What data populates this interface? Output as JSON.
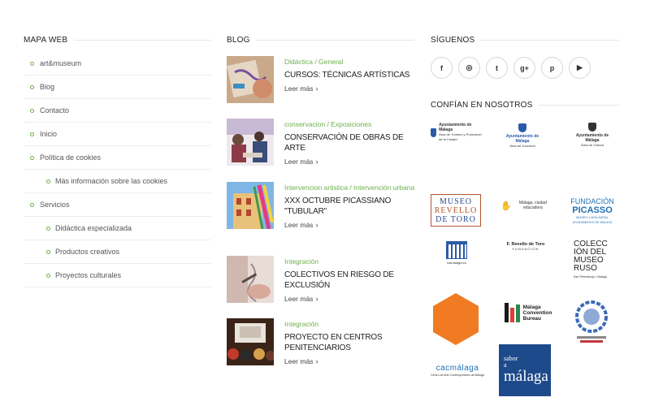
{
  "sitemap": {
    "heading": "MAPA WEB",
    "items": [
      {
        "label": "art&museum",
        "level": 1
      },
      {
        "label": "Blog",
        "level": 1
      },
      {
        "label": "Contacto",
        "level": 1
      },
      {
        "label": "Inicio",
        "level": 1
      },
      {
        "label": "Política de cookies",
        "level": 1
      },
      {
        "label": "Más información sobre las cookies",
        "level": 2
      },
      {
        "label": "Servicios",
        "level": 1
      },
      {
        "label": "Didáctica especializada",
        "level": 2
      },
      {
        "label": "Productos creativos",
        "level": 2
      },
      {
        "label": "Proyectos culturales",
        "level": 2
      }
    ]
  },
  "blog": {
    "heading": "BLOG",
    "read_more": "Leer más",
    "posts": [
      {
        "category": "Didáctica / General",
        "title": "CURSOS: TÉCNICAS ARTÍSTICAS"
      },
      {
        "category": "conservacion / Exposiciones",
        "title": "CONSERVACIÓN DE OBRAS DE ARTE"
      },
      {
        "category": "Intervencion artistica / Intervención urbana",
        "title": "XXX OCTUBRE PICASSIANO \"TUBULAR\""
      },
      {
        "category": "Integración",
        "title": "COLECTIVOS EN RIESGO DE EXCLUSIÓN"
      },
      {
        "category": "Integración",
        "title": "PROYECTO EN CENTROS PENITENCIARIOS"
      }
    ]
  },
  "social": {
    "heading": "SÍGUENOS",
    "icons": [
      "facebook-icon",
      "instagram-icon",
      "twitter-icon",
      "google-plus-icon",
      "pinterest-icon",
      "youtube-icon"
    ],
    "glyphs": [
      "f",
      "◎",
      "t",
      "g+",
      "p",
      "▶"
    ]
  },
  "partners": {
    "heading": "CONFÍAN EN NOSOTROS",
    "logo1": "Ayuntamiento de Málaga",
    "logo1_sub": "Área de Turismo y Promoción de la Ciudad",
    "logo2": "Ayuntamiento de Málaga",
    "logo2_sub": "Área de Juventud",
    "logo3": "Ayuntamiento de Málaga",
    "logo3_sub": "Área de Cultura",
    "museo1": "MUSEO",
    "museo2": "REVELLO",
    "museo3": "DE TORO",
    "malaga_edu": "Málaga, ciudad educadora",
    "fund1": "FUNDACIÓN",
    "fund2": "PICASSO",
    "fund3": "MUSEO CASA NATAL",
    "fund4": "AYUNTAMIENTO DE MÁLAGA",
    "lcma": "lcamalaga.es",
    "frevello1": "F. Revello de Toro",
    "frevello2": "FUNDACIÓN",
    "coleccion": "COLECCIÓN DEL MUSEO RUSO",
    "coleccion_sub": "San Petersburgo / Málaga",
    "mcb1": "Málaga",
    "mcb2": "Convention",
    "mcb3": "Bureau",
    "cac1": "cacmálaga",
    "cac2": "Centro de Arte Contemporáneo de Málaga",
    "sabor1": "sabor",
    "sabor2": "a",
    "sabor3": "málaga",
    "brand_orange": "#f07b22",
    "brand_blue": "#1d4a8a",
    "accent_green": "#6bb04a"
  }
}
